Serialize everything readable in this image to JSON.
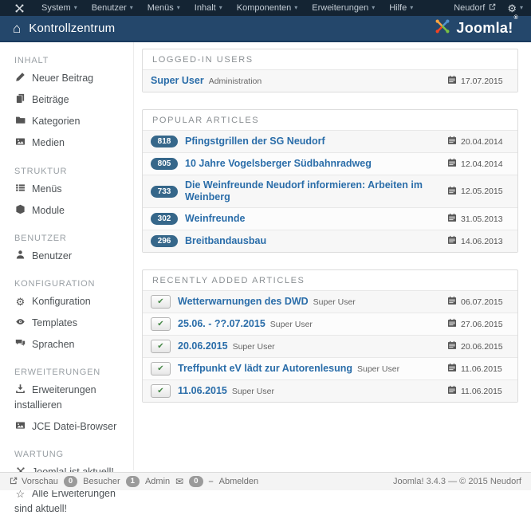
{
  "topbar": {
    "menus": [
      "System",
      "Benutzer",
      "Menüs",
      "Inhalt",
      "Komponenten",
      "Erweiterungen",
      "Hilfe"
    ],
    "site_name": "Neudorf"
  },
  "titlebar": {
    "title": "Kontrollzentrum",
    "brand": "Joomla!",
    "brand_registered": "®"
  },
  "sidebar": {
    "sections": [
      {
        "header": "INHALT",
        "items": [
          {
            "icon": "pencil",
            "label": "Neuer Beitrag"
          },
          {
            "icon": "copy",
            "label": "Beiträge"
          },
          {
            "icon": "folder",
            "label": "Kategorien"
          },
          {
            "icon": "image",
            "label": "Medien"
          }
        ]
      },
      {
        "header": "STRUKTUR",
        "items": [
          {
            "icon": "list",
            "label": "Menüs"
          },
          {
            "icon": "cube",
            "label": "Module"
          }
        ]
      },
      {
        "header": "BENUTZER",
        "items": [
          {
            "icon": "user",
            "label": "Benutzer"
          }
        ]
      },
      {
        "header": "KONFIGURATION",
        "items": [
          {
            "icon": "gear",
            "label": "Konfiguration"
          },
          {
            "icon": "eye",
            "label": "Templates"
          },
          {
            "icon": "comments",
            "label": "Sprachen"
          }
        ]
      },
      {
        "header": "ERWEITERUNGEN",
        "items": [
          {
            "icon": "download",
            "label": "Erweiterungen installieren"
          },
          {
            "icon": "image",
            "label": "JCE Datei-Browser"
          }
        ]
      },
      {
        "header": "WARTUNG",
        "items": [
          {
            "icon": "joomla",
            "label": "Joomla! ist aktuell!"
          },
          {
            "icon": "star",
            "label": "Alle Erweiterungen sind aktuell!"
          }
        ]
      }
    ]
  },
  "panels": [
    {
      "title": "LOGGED-IN USERS",
      "rows": [
        {
          "link": "Super User",
          "meta": "Administration",
          "date": "17.07.2015"
        }
      ]
    },
    {
      "title": "POPULAR ARTICLES",
      "rows": [
        {
          "badge": "818",
          "link": "Pfingstgrillen der SG Neudorf",
          "date": "20.04.2014"
        },
        {
          "badge": "805",
          "link": "10 Jahre Vogelsberger Südbahnradweg",
          "date": "12.04.2014"
        },
        {
          "badge": "733",
          "link": "Die Weinfreunde Neudorf informieren: Arbeiten im Weinberg",
          "date": "12.05.2015"
        },
        {
          "badge": "302",
          "link": "Weinfreunde",
          "date": "31.05.2013"
        },
        {
          "badge": "296",
          "link": "Breitbandausbau",
          "date": "14.06.2013"
        }
      ]
    },
    {
      "title": "RECENTLY ADDED ARTICLES",
      "rows": [
        {
          "check": true,
          "link": "Wetterwarnungen des DWD",
          "meta": "Super User",
          "date": "06.07.2015"
        },
        {
          "check": true,
          "link": "25.06. - ??.07.2015",
          "meta": "Super User",
          "date": "27.06.2015"
        },
        {
          "check": true,
          "link": "20.06.2015",
          "meta": "Super User",
          "date": "20.06.2015"
        },
        {
          "check": true,
          "link": "Treffpunkt eV lädt zur Autorenlesung",
          "meta": "Super User",
          "date": "11.06.2015"
        },
        {
          "check": true,
          "link": "11.06.2015",
          "meta": "Super User",
          "date": "11.06.2015"
        }
      ]
    }
  ],
  "statusbar": {
    "preview": "Vorschau",
    "visitors_count": "0",
    "visitors_label": "Besucher",
    "admin_count": "1",
    "admin_label": "Admin",
    "messages_count": "0",
    "logout": "Abmelden",
    "version": "Joomla! 3.4.3",
    "separator": "—",
    "copyright": "© 2015 Neudorf"
  },
  "colors": {
    "topbar_bg": "#142433",
    "titlebar_bg": "#24476b",
    "link_blue": "#2a6da9",
    "badge_blue": "#36678a",
    "check_green": "#468847",
    "joomla_orange": "#f9a541",
    "joomla_blue": "#5091cd",
    "joomla_green": "#7ac043",
    "joomla_red": "#f44321"
  }
}
